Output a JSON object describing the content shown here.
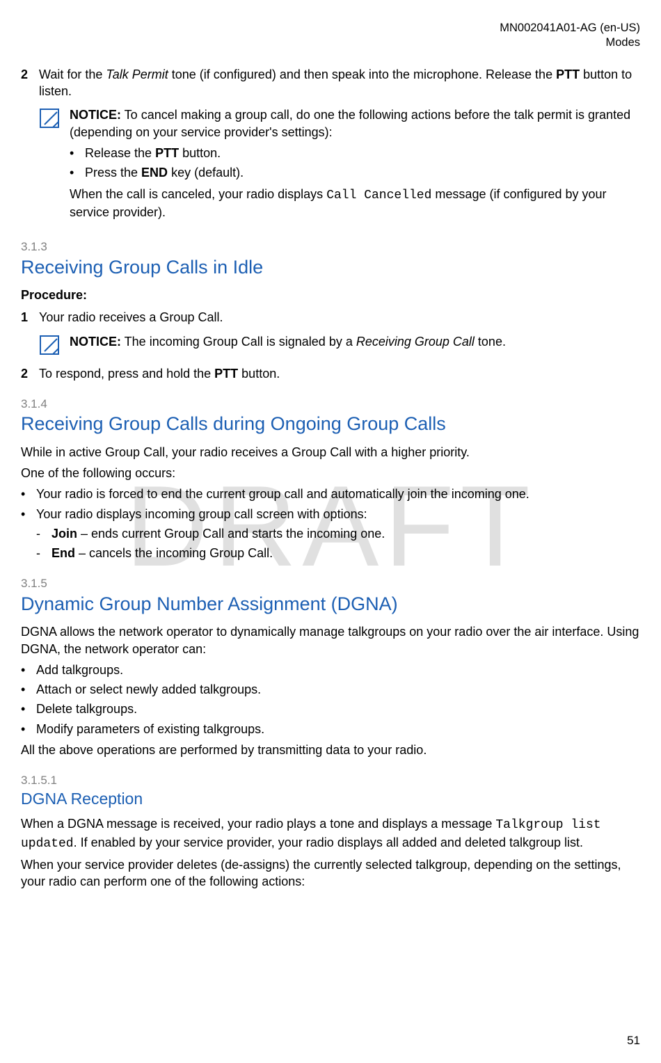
{
  "header": {
    "doc_id": "MN002041A01-AG (en-US)",
    "section": "Modes"
  },
  "watermark": "DRAFT",
  "page_number": "51",
  "step2": {
    "num": "2",
    "text_pre": "Wait for the ",
    "text_italic": "Talk Permit",
    "text_mid": " tone (if configured) and then speak into the microphone. Release the ",
    "text_bold": "PTT",
    "text_post": " button to listen."
  },
  "notice1": {
    "label": "NOTICE:",
    "body": " To cancel making a group call, do one the following actions before the talk permit is granted (depending on your service provider's settings):",
    "bullet1_pre": "Release the ",
    "bullet1_bold": "PTT",
    "bullet1_post": " button.",
    "bullet2_pre": "Press the ",
    "bullet2_bold": "END",
    "bullet2_post": " key (default).",
    "after_pre": "When the call is canceled, your radio displays ",
    "after_mono": "Call Cancelled",
    "after_post": " message (if configured by your service provider)."
  },
  "sec313": {
    "num": "3.1.3",
    "title": "Receiving Group Calls in Idle",
    "procedure_label": "Procedure:",
    "s1_num": "1",
    "s1_text": "Your radio receives a Group Call.",
    "notice_label": "NOTICE:",
    "notice_pre": " The incoming Group Call is signaled by a ",
    "notice_italic": "Receiving Group Call",
    "notice_post": " tone.",
    "s2_num": "2",
    "s2_pre": "To respond, press and hold the ",
    "s2_bold": "PTT",
    "s2_post": " button."
  },
  "sec314": {
    "num": "3.1.4",
    "title": "Receiving Group Calls during Ongoing Group Calls",
    "p1": "While in active Group Call, your radio receives a Group Call with a higher priority.",
    "p2": "One of the following occurs:",
    "b1": "Your radio is forced to end the current group call and automatically join the incoming one.",
    "b2": "Your radio displays incoming group call screen with options:",
    "d1_bold": "Join",
    "d1_post": " – ends current Group Call and starts the incoming one.",
    "d2_bold": "End",
    "d2_post": " – cancels the incoming Group Call."
  },
  "sec315": {
    "num": "3.1.5",
    "title": "Dynamic Group Number Assignment (DGNA)",
    "p1": "DGNA allows the network operator to dynamically manage talkgroups on your radio over the air interface. Using DGNA, the network operator can:",
    "b1": "Add talkgroups.",
    "b2": "Attach or select newly added talkgroups.",
    "b3": "Delete talkgroups.",
    "b4": "Modify parameters of existing talkgroups.",
    "p2": "All the above operations are performed by transmitting data to your radio."
  },
  "sec3151": {
    "num": "3.1.5.1",
    "title": "DGNA Reception",
    "p1_pre": "When a DGNA message is received, your radio plays a tone and displays a message ",
    "p1_mono": "Talkgroup list updated",
    "p1_post": ". If enabled by your service provider, your radio displays all added and deleted talkgroup list.",
    "p2": "When your service provider deletes (de-assigns) the currently selected talkgroup, depending on the settings, your radio can perform one of the following actions:"
  }
}
